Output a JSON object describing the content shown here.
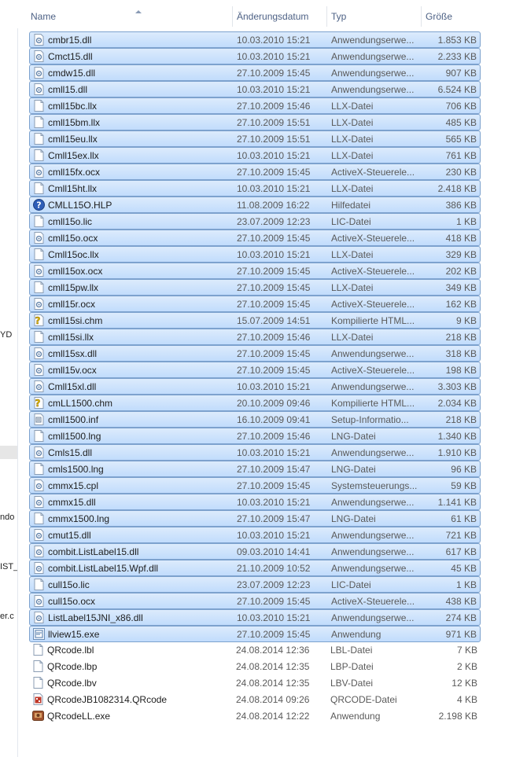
{
  "nav_fragments": [
    "YD",
    "ndo",
    "IST_",
    "er.c"
  ],
  "columns": {
    "name": "Name",
    "date": "Änderungsdatum",
    "type": "Typ",
    "size": "Größe"
  },
  "files": [
    {
      "name": "cmbr15.dll",
      "date": "10.03.2010 15:21",
      "type": "Anwendungserwe...",
      "size": "1.853 KB",
      "icon": "dll",
      "selected": true
    },
    {
      "name": "Cmct15.dll",
      "date": "10.03.2010 15:21",
      "type": "Anwendungserwe...",
      "size": "2.233 KB",
      "icon": "dll",
      "selected": true
    },
    {
      "name": "cmdw15.dll",
      "date": "27.10.2009 15:45",
      "type": "Anwendungserwe...",
      "size": "907 KB",
      "icon": "dll",
      "selected": true
    },
    {
      "name": "cmll15.dll",
      "date": "10.03.2010 15:21",
      "type": "Anwendungserwe...",
      "size": "6.524 KB",
      "icon": "dll",
      "selected": true
    },
    {
      "name": "cmll15bc.llx",
      "date": "27.10.2009 15:46",
      "type": "LLX-Datei",
      "size": "706 KB",
      "icon": "file",
      "selected": true
    },
    {
      "name": "cmll15bm.llx",
      "date": "27.10.2009 15:51",
      "type": "LLX-Datei",
      "size": "485 KB",
      "icon": "file",
      "selected": true
    },
    {
      "name": "cmll15eu.llx",
      "date": "27.10.2009 15:51",
      "type": "LLX-Datei",
      "size": "565 KB",
      "icon": "file",
      "selected": true
    },
    {
      "name": "Cmll15ex.llx",
      "date": "10.03.2010 15:21",
      "type": "LLX-Datei",
      "size": "761 KB",
      "icon": "file",
      "selected": true
    },
    {
      "name": "cmll15fx.ocx",
      "date": "27.10.2009 15:45",
      "type": "ActiveX-Steuerele...",
      "size": "230 KB",
      "icon": "dll",
      "selected": true
    },
    {
      "name": "Cmll15ht.llx",
      "date": "10.03.2010 15:21",
      "type": "LLX-Datei",
      "size": "2.418 KB",
      "icon": "file",
      "selected": true
    },
    {
      "name": "CMLL15O.HLP",
      "date": "11.08.2009 16:22",
      "type": "Hilfedatei",
      "size": "386 KB",
      "icon": "help",
      "selected": true
    },
    {
      "name": "cmll15o.lic",
      "date": "23.07.2009 12:23",
      "type": "LIC-Datei",
      "size": "1 KB",
      "icon": "file",
      "selected": true
    },
    {
      "name": "cmll15o.ocx",
      "date": "27.10.2009 15:45",
      "type": "ActiveX-Steuerele...",
      "size": "418 KB",
      "icon": "dll",
      "selected": true
    },
    {
      "name": "Cmll15oc.llx",
      "date": "10.03.2010 15:21",
      "type": "LLX-Datei",
      "size": "329 KB",
      "icon": "file",
      "selected": true
    },
    {
      "name": "cmll15ox.ocx",
      "date": "27.10.2009 15:45",
      "type": "ActiveX-Steuerele...",
      "size": "202 KB",
      "icon": "dll",
      "selected": true
    },
    {
      "name": "cmll15pw.llx",
      "date": "27.10.2009 15:45",
      "type": "LLX-Datei",
      "size": "349 KB",
      "icon": "file",
      "selected": true
    },
    {
      "name": "cmll15r.ocx",
      "date": "27.10.2009 15:45",
      "type": "ActiveX-Steuerele...",
      "size": "162 KB",
      "icon": "dll",
      "selected": true
    },
    {
      "name": "cmll15si.chm",
      "date": "15.07.2009 14:51",
      "type": "Kompilierte HTML...",
      "size": "9 KB",
      "icon": "chm",
      "selected": true
    },
    {
      "name": "cmll15si.llx",
      "date": "27.10.2009 15:46",
      "type": "LLX-Datei",
      "size": "218 KB",
      "icon": "file",
      "selected": true
    },
    {
      "name": "cmll15sx.dll",
      "date": "27.10.2009 15:45",
      "type": "Anwendungserwe...",
      "size": "318 KB",
      "icon": "dll",
      "selected": true
    },
    {
      "name": "cmll15v.ocx",
      "date": "27.10.2009 15:45",
      "type": "ActiveX-Steuerele...",
      "size": "198 KB",
      "icon": "dll",
      "selected": true
    },
    {
      "name": "Cmll15xl.dll",
      "date": "10.03.2010 15:21",
      "type": "Anwendungserwe...",
      "size": "3.303 KB",
      "icon": "dll",
      "selected": true
    },
    {
      "name": "cmLL1500.chm",
      "date": "20.10.2009 09:46",
      "type": "Kompilierte HTML...",
      "size": "2.034 KB",
      "icon": "chm",
      "selected": true
    },
    {
      "name": "cmll1500.inf",
      "date": "16.10.2009 09:41",
      "type": "Setup-Informatio...",
      "size": "218 KB",
      "icon": "inf",
      "selected": true
    },
    {
      "name": "cmll1500.lng",
      "date": "27.10.2009 15:46",
      "type": "LNG-Datei",
      "size": "1.340 KB",
      "icon": "file",
      "selected": true
    },
    {
      "name": "Cmls15.dll",
      "date": "10.03.2010 15:21",
      "type": "Anwendungserwe...",
      "size": "1.910 KB",
      "icon": "dll",
      "selected": true
    },
    {
      "name": "cmls1500.lng",
      "date": "27.10.2009 15:47",
      "type": "LNG-Datei",
      "size": "96 KB",
      "icon": "file",
      "selected": true
    },
    {
      "name": "cmmx15.cpl",
      "date": "27.10.2009 15:45",
      "type": "Systemsteuerungs...",
      "size": "59 KB",
      "icon": "dll",
      "selected": true
    },
    {
      "name": "cmmx15.dll",
      "date": "10.03.2010 15:21",
      "type": "Anwendungserwe...",
      "size": "1.141 KB",
      "icon": "dll",
      "selected": true
    },
    {
      "name": "cmmx1500.lng",
      "date": "27.10.2009 15:47",
      "type": "LNG-Datei",
      "size": "61 KB",
      "icon": "file",
      "selected": true
    },
    {
      "name": "cmut15.dll",
      "date": "10.03.2010 15:21",
      "type": "Anwendungserwe...",
      "size": "721 KB",
      "icon": "dll",
      "selected": true
    },
    {
      "name": "combit.ListLabel15.dll",
      "date": "09.03.2010 14:41",
      "type": "Anwendungserwe...",
      "size": "617 KB",
      "icon": "dll",
      "selected": true
    },
    {
      "name": "combit.ListLabel15.Wpf.dll",
      "date": "21.10.2009 10:52",
      "type": "Anwendungserwe...",
      "size": "45 KB",
      "icon": "dll",
      "selected": true
    },
    {
      "name": "cull15o.lic",
      "date": "23.07.2009 12:23",
      "type": "LIC-Datei",
      "size": "1 KB",
      "icon": "file",
      "selected": true
    },
    {
      "name": "cull15o.ocx",
      "date": "27.10.2009 15:45",
      "type": "ActiveX-Steuerele...",
      "size": "438 KB",
      "icon": "dll",
      "selected": true
    },
    {
      "name": "ListLabel15JNI_x86.dll",
      "date": "10.03.2010 15:21",
      "type": "Anwendungserwe...",
      "size": "274 KB",
      "icon": "dll",
      "selected": true
    },
    {
      "name": "llview15.exe",
      "date": "27.10.2009 15:45",
      "type": "Anwendung",
      "size": "971 KB",
      "icon": "exe",
      "selected": true
    },
    {
      "name": "QRcode.lbl",
      "date": "24.08.2014 12:36",
      "type": "LBL-Datei",
      "size": "7 KB",
      "icon": "file",
      "selected": false
    },
    {
      "name": "QRcode.lbp",
      "date": "24.08.2014 12:35",
      "type": "LBP-Datei",
      "size": "2 KB",
      "icon": "file",
      "selected": false
    },
    {
      "name": "QRcode.lbv",
      "date": "24.08.2014 12:35",
      "type": "LBV-Datei",
      "size": "12 KB",
      "icon": "file",
      "selected": false
    },
    {
      "name": "QRcodeJB1082314.QRcode",
      "date": "24.08.2014 09:26",
      "type": "QRCODE-Datei",
      "size": "4 KB",
      "icon": "qrcode",
      "selected": false
    },
    {
      "name": "QRcodeLL.exe",
      "date": "24.08.2014 12:22",
      "type": "Anwendung",
      "size": "2.198 KB",
      "icon": "app",
      "selected": false
    }
  ]
}
